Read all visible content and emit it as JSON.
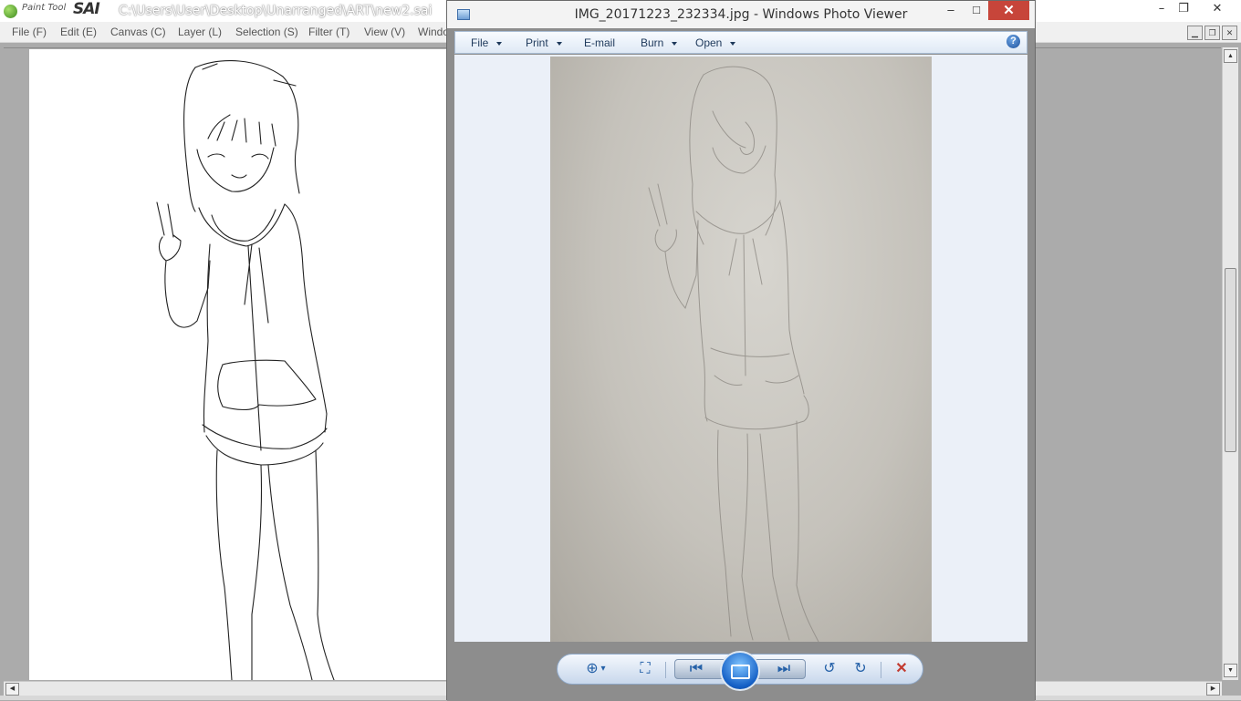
{
  "sai": {
    "app_name_small": "Paint Tool",
    "app_name_big": "SAI",
    "file_path": "C:\\Users\\User\\Desktop\\Unarranged\\ART\\new2.sai",
    "window_controls": {
      "minimize": "–",
      "restore": "❐",
      "close": "✕"
    },
    "menu": [
      "File (F)",
      "Edit (E)",
      "Canvas (C)",
      "Layer (L)",
      "Selection (S)",
      "Filter (T)",
      "View (V)",
      "Windo"
    ],
    "mdi_controls": {
      "minimize": "▁",
      "restore": "❐",
      "close": "✕"
    },
    "scroll_arrows": {
      "up": "▲",
      "down": "▼",
      "left": "◀",
      "right": "▶"
    }
  },
  "photo_viewer": {
    "title": "IMG_20171223_232334.jpg - Windows Photo Viewer",
    "window_controls": {
      "minimize": "–",
      "maximize": "□",
      "close": "✕"
    },
    "toolbar": {
      "file": "File",
      "print": "Print",
      "email": "E-mail",
      "burn": "Burn",
      "open": "Open",
      "help": "?"
    },
    "controls": {
      "zoom": "⊕",
      "zoom_caret": "▾",
      "actual_size": "⛶",
      "previous": "⏮",
      "next": "⏭",
      "rotate_ccw": "↺",
      "rotate_cw": "↻",
      "delete": "✕"
    },
    "colors": {
      "accent": "#1560c6",
      "delete": "#c33b30",
      "close_button": "#c7453a"
    }
  }
}
